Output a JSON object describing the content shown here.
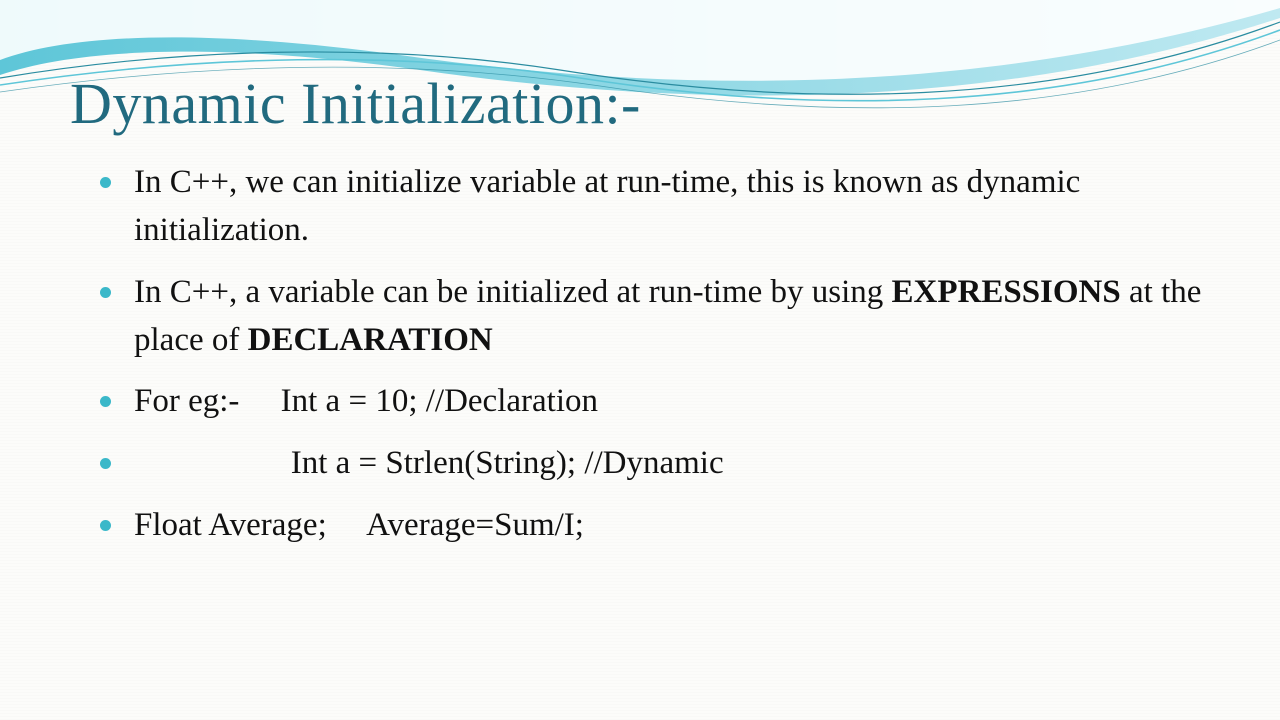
{
  "title": "Dynamic Initialization:-",
  "bullets": [
    {
      "pre": "In C++, we can initialize variable at run-time, this is known as dynamic initialization."
    },
    {
      "pre": "In C++, a variable can be initialized at run-time by using ",
      "bold1": "EXPRESSIONS",
      "mid": " at the place of ",
      "bold2": "DECLARATION"
    },
    {
      "pre": "For eg:-     Int a = 10; //Declaration"
    },
    {
      "pre": "                   Int a = Strlen(String); //Dynamic"
    },
    {
      "pre": "Float Average;     Average=Sum/I;"
    }
  ]
}
